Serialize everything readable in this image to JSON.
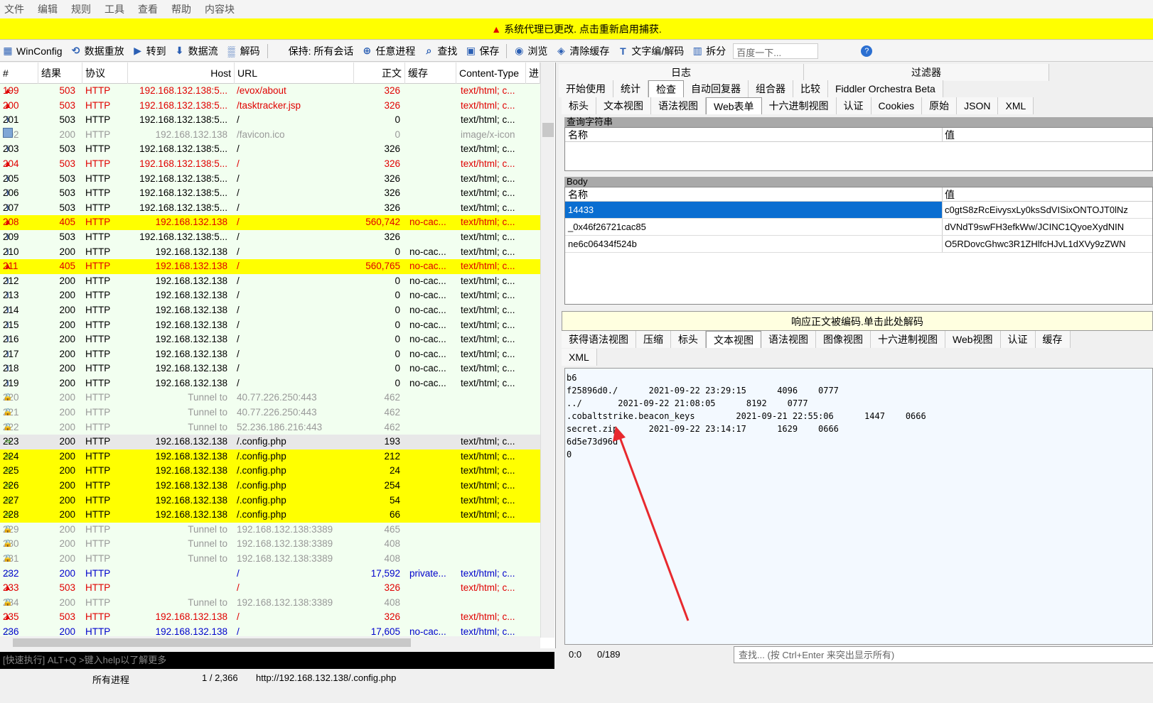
{
  "menu": [
    "文件",
    "编辑",
    "规则",
    "工具",
    "查看",
    "帮助",
    "内容块"
  ],
  "banner": {
    "text": "系统代理已更改. 点击重新启用捕获."
  },
  "toolbar": {
    "items": [
      "WinConfig",
      "数据重放",
      "转到",
      "数据流",
      "解码",
      "保持: 所有会话",
      "任意进程",
      "查找",
      "保存",
      "浏览",
      "清除缓存",
      "文字编/解码",
      "拆分"
    ],
    "search_placeholder": "百度一下..."
  },
  "session_columns": [
    "#",
    "结果",
    "协议",
    "Host",
    "URL",
    "正文",
    "缓存",
    "Content-Type",
    "进"
  ],
  "sessions": [
    {
      "id": "199",
      "result": "503",
      "proto": "HTTP",
      "host": "192.168.132.138:5...",
      "url": "/evox/about",
      "body": "326",
      "cache": "",
      "ctype": "text/html; c...",
      "icon": "error",
      "style": "red"
    },
    {
      "id": "200",
      "result": "503",
      "proto": "HTTP",
      "host": "192.168.132.138:5...",
      "url": "/tasktracker.jsp",
      "body": "326",
      "cache": "",
      "ctype": "text/html; c...",
      "icon": "error",
      "style": "red"
    },
    {
      "id": "201",
      "result": "503",
      "proto": "HTTP",
      "host": "192.168.132.138:5...",
      "url": "/",
      "body": "0",
      "cache": "",
      "ctype": "text/html; c...",
      "icon": "info",
      "style": "normal"
    },
    {
      "id": "202",
      "result": "200",
      "proto": "HTTP",
      "host": "192.168.132.138",
      "url": "/favicon.ico",
      "body": "0",
      "cache": "",
      "ctype": "image/x-icon",
      "icon": "image",
      "style": "gray"
    },
    {
      "id": "203",
      "result": "503",
      "proto": "HTTP",
      "host": "192.168.132.138:5...",
      "url": "/",
      "body": "326",
      "cache": "",
      "ctype": "text/html; c...",
      "icon": "info",
      "style": "normal"
    },
    {
      "id": "204",
      "result": "503",
      "proto": "HTTP",
      "host": "192.168.132.138:5...",
      "url": "/",
      "body": "326",
      "cache": "",
      "ctype": "text/html; c...",
      "icon": "error",
      "style": "red"
    },
    {
      "id": "205",
      "result": "503",
      "proto": "HTTP",
      "host": "192.168.132.138:5...",
      "url": "/",
      "body": "326",
      "cache": "",
      "ctype": "text/html; c...",
      "icon": "info",
      "style": "normal"
    },
    {
      "id": "206",
      "result": "503",
      "proto": "HTTP",
      "host": "192.168.132.138:5...",
      "url": "/",
      "body": "326",
      "cache": "",
      "ctype": "text/html; c...",
      "icon": "info",
      "style": "normal"
    },
    {
      "id": "207",
      "result": "503",
      "proto": "HTTP",
      "host": "192.168.132.138:5...",
      "url": "/",
      "body": "326",
      "cache": "",
      "ctype": "text/html; c...",
      "icon": "info",
      "style": "normal"
    },
    {
      "id": "208",
      "result": "405",
      "proto": "HTTP",
      "host": "192.168.132.138",
      "url": "/",
      "body": "560,742",
      "cache": "no-cac...",
      "ctype": "text/html; c...",
      "icon": "error",
      "style": "red-yellow"
    },
    {
      "id": "209",
      "result": "503",
      "proto": "HTTP",
      "host": "192.168.132.138:5...",
      "url": "/",
      "body": "326",
      "cache": "",
      "ctype": "text/html; c...",
      "icon": "info",
      "style": "normal"
    },
    {
      "id": "210",
      "result": "200",
      "proto": "HTTP",
      "host": "192.168.132.138",
      "url": "/",
      "body": "0",
      "cache": "no-cac...",
      "ctype": "text/html; c...",
      "icon": "info",
      "style": "normal"
    },
    {
      "id": "211",
      "result": "405",
      "proto": "HTTP",
      "host": "192.168.132.138",
      "url": "/",
      "body": "560,765",
      "cache": "no-cac...",
      "ctype": "text/html; c...",
      "icon": "error",
      "style": "red-yellow"
    },
    {
      "id": "212",
      "result": "200",
      "proto": "HTTP",
      "host": "192.168.132.138",
      "url": "/",
      "body": "0",
      "cache": "no-cac...",
      "ctype": "text/html; c...",
      "icon": "info",
      "style": "normal"
    },
    {
      "id": "213",
      "result": "200",
      "proto": "HTTP",
      "host": "192.168.132.138",
      "url": "/",
      "body": "0",
      "cache": "no-cac...",
      "ctype": "text/html; c...",
      "icon": "info",
      "style": "normal"
    },
    {
      "id": "214",
      "result": "200",
      "proto": "HTTP",
      "host": "192.168.132.138",
      "url": "/",
      "body": "0",
      "cache": "no-cac...",
      "ctype": "text/html; c...",
      "icon": "info",
      "style": "normal"
    },
    {
      "id": "215",
      "result": "200",
      "proto": "HTTP",
      "host": "192.168.132.138",
      "url": "/",
      "body": "0",
      "cache": "no-cac...",
      "ctype": "text/html; c...",
      "icon": "info",
      "style": "normal"
    },
    {
      "id": "216",
      "result": "200",
      "proto": "HTTP",
      "host": "192.168.132.138",
      "url": "/",
      "body": "0",
      "cache": "no-cac...",
      "ctype": "text/html; c...",
      "icon": "info",
      "style": "normal"
    },
    {
      "id": "217",
      "result": "200",
      "proto": "HTTP",
      "host": "192.168.132.138",
      "url": "/",
      "body": "0",
      "cache": "no-cac...",
      "ctype": "text/html; c...",
      "icon": "info",
      "style": "normal"
    },
    {
      "id": "218",
      "result": "200",
      "proto": "HTTP",
      "host": "192.168.132.138",
      "url": "/",
      "body": "0",
      "cache": "no-cac...",
      "ctype": "text/html; c...",
      "icon": "info",
      "style": "normal"
    },
    {
      "id": "219",
      "result": "200",
      "proto": "HTTP",
      "host": "192.168.132.138",
      "url": "/",
      "body": "0",
      "cache": "no-cac...",
      "ctype": "text/html; c...",
      "icon": "info",
      "style": "normal"
    },
    {
      "id": "220",
      "result": "200",
      "proto": "HTTP",
      "host": "Tunnel to",
      "url": "40.77.226.250:443",
      "body": "462",
      "cache": "",
      "ctype": "",
      "icon": "lock",
      "style": "gray"
    },
    {
      "id": "221",
      "result": "200",
      "proto": "HTTP",
      "host": "Tunnel to",
      "url": "40.77.226.250:443",
      "body": "462",
      "cache": "",
      "ctype": "",
      "icon": "lock",
      "style": "gray"
    },
    {
      "id": "222",
      "result": "200",
      "proto": "HTTP",
      "host": "Tunnel to",
      "url": "52.236.186.216:443",
      "body": "462",
      "cache": "",
      "ctype": "",
      "icon": "lock",
      "style": "gray"
    },
    {
      "id": "223",
      "result": "200",
      "proto": "HTTP",
      "host": "192.168.132.138",
      "url": "/.config.php",
      "body": "193",
      "cache": "",
      "ctype": "text/html; c...",
      "icon": "arrow",
      "style": "selected"
    },
    {
      "id": "224",
      "result": "200",
      "proto": "HTTP",
      "host": "192.168.132.138",
      "url": "/.config.php",
      "body": "212",
      "cache": "",
      "ctype": "text/html; c...",
      "icon": "arrow",
      "style": "yellow"
    },
    {
      "id": "225",
      "result": "200",
      "proto": "HTTP",
      "host": "192.168.132.138",
      "url": "/.config.php",
      "body": "24",
      "cache": "",
      "ctype": "text/html; c...",
      "icon": "arrow",
      "style": "yellow"
    },
    {
      "id": "226",
      "result": "200",
      "proto": "HTTP",
      "host": "192.168.132.138",
      "url": "/.config.php",
      "body": "254",
      "cache": "",
      "ctype": "text/html; c...",
      "icon": "arrow",
      "style": "yellow"
    },
    {
      "id": "227",
      "result": "200",
      "proto": "HTTP",
      "host": "192.168.132.138",
      "url": "/.config.php",
      "body": "54",
      "cache": "",
      "ctype": "text/html; c...",
      "icon": "arrow",
      "style": "yellow"
    },
    {
      "id": "228",
      "result": "200",
      "proto": "HTTP",
      "host": "192.168.132.138",
      "url": "/.config.php",
      "body": "66",
      "cache": "",
      "ctype": "text/html; c...",
      "icon": "arrow",
      "style": "yellow"
    },
    {
      "id": "229",
      "result": "200",
      "proto": "HTTP",
      "host": "Tunnel to",
      "url": "192.168.132.138:3389",
      "body": "465",
      "cache": "",
      "ctype": "",
      "icon": "lock",
      "style": "gray"
    },
    {
      "id": "230",
      "result": "200",
      "proto": "HTTP",
      "host": "Tunnel to",
      "url": "192.168.132.138:3389",
      "body": "408",
      "cache": "",
      "ctype": "",
      "icon": "lock",
      "style": "gray"
    },
    {
      "id": "231",
      "result": "200",
      "proto": "HTTP",
      "host": "Tunnel to",
      "url": "192.168.132.138:3389",
      "body": "408",
      "cache": "",
      "ctype": "",
      "icon": "lock",
      "style": "gray"
    },
    {
      "id": "232",
      "result": "200",
      "proto": "HTTP",
      "host": "",
      "url": "/",
      "body": "17,592",
      "cache": "private...",
      "ctype": "text/html; c...",
      "icon": "ws",
      "style": "blue"
    },
    {
      "id": "233",
      "result": "503",
      "proto": "HTTP",
      "host": "",
      "url": "/",
      "body": "326",
      "cache": "",
      "ctype": "text/html; c...",
      "icon": "error",
      "style": "red"
    },
    {
      "id": "234",
      "result": "200",
      "proto": "HTTP",
      "host": "Tunnel to",
      "url": "192.168.132.138:3389",
      "body": "408",
      "cache": "",
      "ctype": "",
      "icon": "lock",
      "style": "gray"
    },
    {
      "id": "235",
      "result": "503",
      "proto": "HTTP",
      "host": "192.168.132.138",
      "url": "/",
      "body": "326",
      "cache": "",
      "ctype": "text/html; c...",
      "icon": "error",
      "style": "red"
    },
    {
      "id": "236",
      "result": "200",
      "proto": "HTTP",
      "host": "192.168.132.138",
      "url": "/",
      "body": "17,605",
      "cache": "no-cac...",
      "ctype": "text/html; c...",
      "icon": "ws",
      "style": "blue"
    }
  ],
  "quickexec": "[快速执行] ALT+Q >键入help以了解更多",
  "status": {
    "process": "所有进程",
    "count": "1 / 2,366",
    "url": "http://192.168.132.138/.config.php"
  },
  "right": {
    "top_tabs_a": [
      "日志",
      "过滤器"
    ],
    "top_tabs_b": [
      "开始使用",
      "统计",
      "检查",
      "自动回复器",
      "组合器",
      "比较",
      "Fiddler Orchestra Beta"
    ],
    "req_tabs": [
      "标头",
      "文本视图",
      "语法视图",
      "Web表单",
      "十六进制视图",
      "认证",
      "Cookies",
      "原始",
      "JSON",
      "XML"
    ],
    "querystring_label": "查询字符串",
    "name_col": "名称",
    "value_col": "值",
    "body_label": "Body",
    "body_rows": [
      {
        "name": "14433",
        "value": "c0gtS8zRcEivysxLy0ksSdVISixONTOJT0lNz"
      },
      {
        "name": "_0x46f26721cac85",
        "value": "dVNdT9swFH3efkWw/JCINC1QyoeXydNIN"
      },
      {
        "name": "ne6c06434f524b",
        "value": "O5RDovcGhwc3R1ZHlfcHJvL1dXVy9zZWN"
      }
    ],
    "decode_bar": "响应正文被编码.单击此处解码",
    "resp_tabs": [
      "获得语法视图",
      "压缩",
      "标头",
      "文本视图",
      "语法视图",
      "图像视图",
      "十六进制视图",
      "Web视图",
      "认证",
      "缓存"
    ],
    "resp_tab_xml": "XML",
    "textview": [
      "b6",
      "f25896d0./      2021-09-22 23:29:15      4096    0777",
      "../       2021-09-22 21:08:05      8192    0777",
      ".cobaltstrike.beacon_keys        2021-09-21 22:55:06      1447    0666",
      "secret.zip      2021-09-22 23:14:17      1629    0666",
      "6d5e73d96d",
      "0"
    ],
    "pos": "0:0",
    "len": "0/189",
    "find_placeholder": "查找... (按 Ctrl+Enter 来突出显示所有)"
  },
  "colors": {
    "error": "#e00000",
    "highlight": "#ffff00",
    "selected": "#e8e8e8",
    "blue": "#0000cc",
    "row_bg": "#f2fff0"
  }
}
